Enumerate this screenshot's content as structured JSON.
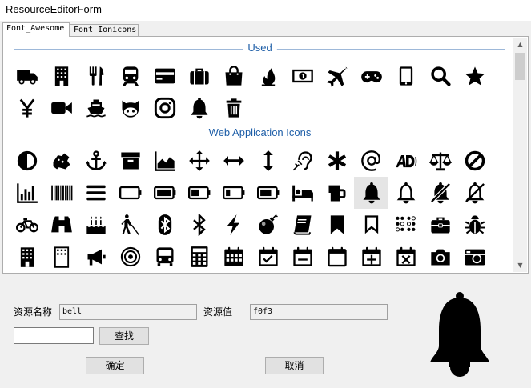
{
  "window": {
    "title": "ResourceEditorForm"
  },
  "tabs": [
    {
      "label": "Font_Awesome",
      "active": true
    },
    {
      "label": "Font_Ionicons",
      "active": false
    }
  ],
  "sections": [
    {
      "title": "Used",
      "icons": [
        "truck-icon",
        "building-icon",
        "cutlery-icon",
        "train-icon",
        "credit-card-icon",
        "suitcase-icon",
        "shopping-bag-icon",
        "fire-icon",
        "money-icon",
        "plane-icon",
        "gamepad-icon",
        "tablet-icon",
        "search-icon",
        "star-icon",
        "yen-icon",
        "video-camera-icon",
        "ship-icon",
        "github-icon",
        "instagram-icon",
        "bell-icon",
        "trash-icon"
      ]
    },
    {
      "title": "Web Application Icons",
      "icons": [
        "adjust-icon",
        "sign-language-icon",
        "anchor-icon",
        "archive-icon",
        "area-chart-icon",
        "arrows-icon",
        "arrows-h-icon",
        "arrows-v-icon",
        "assistive-listening-icon",
        "asterisk-icon",
        "at-icon",
        "audio-description-icon",
        "balance-scale-icon",
        "ban-icon",
        "bar-chart-icon",
        "barcode-icon",
        "bars-icon",
        "battery-empty-icon",
        "battery-full-icon",
        "battery-half-icon",
        "battery-quarter-icon",
        "battery-three-quarters-icon",
        "bed-icon",
        "beer-icon",
        "bell-icon",
        "bell-o-icon",
        "bell-slash-icon",
        "bell-slash-o-icon",
        "bicycle-icon",
        "binoculars-icon",
        "birthday-cake-icon",
        "blind-icon",
        "bluetooth-icon",
        "bluetooth-b-icon",
        "bolt-icon",
        "bomb-icon",
        "book-icon",
        "bookmark-icon",
        "bookmark-o-icon",
        "braille-icon",
        "briefcase-icon",
        "bug-icon",
        "building-icon",
        "building-o-icon",
        "bullhorn-icon",
        "bullseye-icon",
        "bus-icon",
        "calculator-icon",
        "calendar-icon",
        "calendar-check-icon",
        "calendar-minus-icon",
        "calendar-o-icon",
        "calendar-plus-icon",
        "calendar-times-icon",
        "camera-icon",
        "camera-retro-icon"
      ],
      "selected_index": 24
    }
  ],
  "form": {
    "name_label": "资源名称",
    "name_value": "bell",
    "value_label": "资源值",
    "value_value": "f0f3",
    "search_value": "",
    "search_button": "查找",
    "ok_button": "确定",
    "cancel_button": "取消"
  },
  "preview": {
    "icon": "bell-icon"
  }
}
